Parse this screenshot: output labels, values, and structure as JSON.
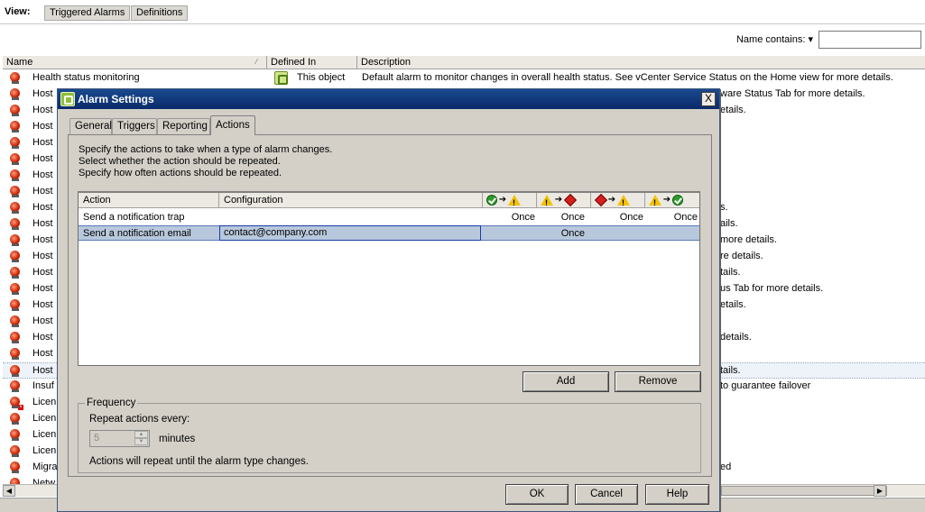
{
  "view": {
    "label": "View:",
    "buttons": [
      "Triggered Alarms",
      "Definitions"
    ]
  },
  "filter": {
    "label": "Name contains: ▾",
    "value": ""
  },
  "list": {
    "columns": [
      "Name",
      "Defined In",
      "Description"
    ],
    "rows": [
      {
        "name": "Health status monitoring",
        "defined_in": "This object",
        "description": "Default alarm to monitor changes in overall health status. See vCenter Service Status on the Home view for more details."
      },
      {
        "name": "Host",
        "description": "ware Status Tab for more details."
      },
      {
        "name": "Host",
        "description": "etails."
      },
      {
        "name": "Host",
        "description": ""
      },
      {
        "name": "Host",
        "description": ""
      },
      {
        "name": "Host",
        "description": ""
      },
      {
        "name": "Host",
        "description": ""
      },
      {
        "name": "Host",
        "description": ""
      },
      {
        "name": "Host",
        "description": "s."
      },
      {
        "name": "Host",
        "description": "ails."
      },
      {
        "name": "Host",
        "description": "more details."
      },
      {
        "name": "Host",
        "description": "re details."
      },
      {
        "name": "Host",
        "description": "tails."
      },
      {
        "name": "Host",
        "description": "us Tab for more details."
      },
      {
        "name": "Host",
        "description": "etails."
      },
      {
        "name": "Host",
        "description": ""
      },
      {
        "name": "Host",
        "description": "details."
      },
      {
        "name": "Host",
        "description": ""
      },
      {
        "name": "Host",
        "description": "tails."
      },
      {
        "name": "Insuf",
        "description": "to guarantee failover"
      },
      {
        "name": "Licen",
        "description": ""
      },
      {
        "name": "Licen",
        "description": ""
      },
      {
        "name": "Licen",
        "description": ""
      },
      {
        "name": "Licen",
        "description": ""
      },
      {
        "name": "Migra",
        "description": "ed"
      },
      {
        "name": "Netw",
        "description": ""
      }
    ]
  },
  "dialog": {
    "title": "Alarm Settings",
    "close": "X",
    "tabs": [
      "General",
      "Triggers",
      "Reporting",
      "Actions"
    ],
    "active_tab": "Actions",
    "instructions": [
      "Specify the actions to take when a type of alarm changes.",
      "Select whether the action should be repeated.",
      "Specify how often actions should be repeated."
    ],
    "grid": {
      "columns": [
        "Action",
        "Configuration"
      ],
      "transitions": [
        {
          "from": "ok",
          "to": "warning"
        },
        {
          "from": "warning",
          "to": "critical"
        },
        {
          "from": "critical",
          "to": "warning"
        },
        {
          "from": "warning",
          "to": "ok"
        }
      ],
      "arrow": "➔",
      "rows": [
        {
          "action": "Send a notification trap",
          "configuration": "",
          "t1": "Once",
          "t2": "Once",
          "t3": "Once",
          "t4": "Once"
        },
        {
          "action": "Send a notification email",
          "configuration": "contact@company.com",
          "t1": "",
          "t2": "Once",
          "t3": "",
          "t4": ""
        }
      ]
    },
    "buttons": {
      "add": "Add",
      "remove": "Remove",
      "ok": "OK",
      "cancel": "Cancel",
      "help": "Help"
    },
    "frequency": {
      "legend": "Frequency",
      "repeat_label": "Repeat actions every:",
      "value": "5",
      "unit": "minutes",
      "note": "Actions will repeat until the alarm type changes."
    }
  }
}
